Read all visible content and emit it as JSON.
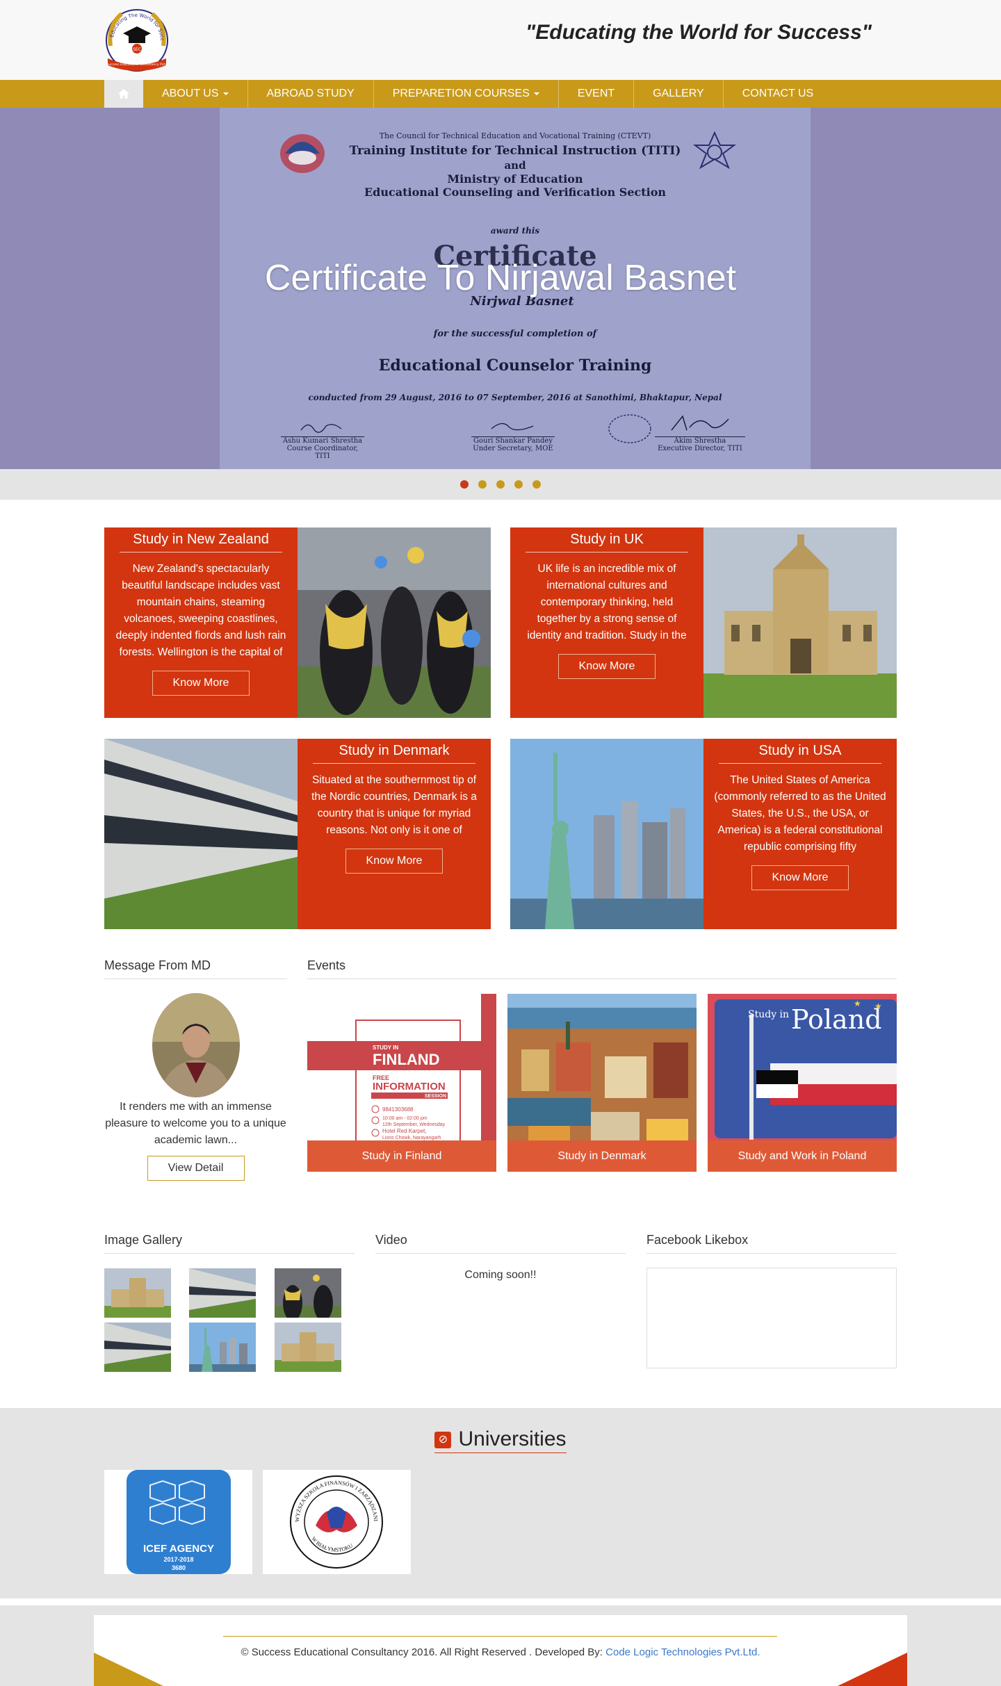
{
  "header": {
    "tagline": "\"Educating the World for Success\"",
    "logo": {
      "arc_text": "Educating The World for Success",
      "center_text": "SEC",
      "ribbon_text": "Success Educational Consultancy P.Ltd"
    }
  },
  "nav": {
    "home_icon": "home-icon",
    "items": [
      {
        "label": "ABOUT US",
        "dropdown": true
      },
      {
        "label": "ABROAD STUDY",
        "dropdown": false
      },
      {
        "label": "PREPARETION COURSES",
        "dropdown": true
      },
      {
        "label": "EVENT",
        "dropdown": false
      },
      {
        "label": "GALLERY",
        "dropdown": false
      },
      {
        "label": "CONTACT US",
        "dropdown": false
      }
    ]
  },
  "slider": {
    "caption": "Certificate To Nirjawal Basnet",
    "active_dot": 1,
    "dot_count": 5,
    "certificate": {
      "line1": "The Council for Technical Education and Vocational Training (CTEVT)",
      "line2": "Training Institute for Technical Instruction (TITI)",
      "line3": "and",
      "line4": "Ministry of Education",
      "line5": "Educational Counseling and Verification Section",
      "award": "award this",
      "heading": "Certificate",
      "name": "Nirjwal Basnet",
      "for": "for the successful completion of",
      "course": "Educational Counselor Training",
      "conducted": "conducted from 29 August, 2016  to 07 September, 2016 at Sanothimi, Bhaktapur, Nepal",
      "sig1_name": "Ashu Kumari Shrestha",
      "sig1_role": "Course Coordinator, TITI",
      "sig2_name": "Gouri Shankar Pandey",
      "sig2_role": "Under Secretary, MOE",
      "sig3_name": "Akim Shrestha",
      "sig3_role": "Executive Director, TITI"
    }
  },
  "countries": [
    {
      "title": "Study in New Zealand",
      "desc": "New Zealand's spectacularly beautiful landscape includes vast mountain chains, steaming volcanoes, sweeping coastlines, deeply indented fiords and lush rain forests. Wellington is the capital of",
      "button": "Know More"
    },
    {
      "title": "Study in UK",
      "desc": "UK life is an incredible mix of international cultures and contemporary thinking, held together by a strong sense of identity and tradition. Study in the",
      "button": "Know More"
    },
    {
      "title": "Study in Denmark",
      "desc": "Situated at the southernmost tip of the Nordic countries, Denmark is a country that is unique for myriad reasons. Not only is it one of",
      "button": "Know More"
    },
    {
      "title": "Study in USA",
      "desc": "The United States of America (commonly referred to as the United States, the U.S., the USA, or America) is a federal constitutional republic comprising fifty",
      "button": "Know More"
    }
  ],
  "message": {
    "title": "Message From MD",
    "text": "It renders me with an immense pleasure to welcome you to a unique academic lawn...",
    "button": "View Detail"
  },
  "events": {
    "title": "Events",
    "items": [
      {
        "label": "Study in Finland",
        "poster": {
          "study_in": "STUDY IN",
          "country": "FINLAND",
          "free": "FREE",
          "info": "INFORMATION",
          "session": "SESSION",
          "phone": "9841303688",
          "time": "10:00 am - 02:00 pm",
          "date": "12th September, Wednesday",
          "venue1": "Hotel Red Karpet,",
          "venue2": "Lions Chowk, Narayangarh"
        }
      },
      {
        "label": "Study in Denmark"
      },
      {
        "label": "Study and Work in Poland",
        "poster": {
          "study_in": "Study in",
          "country": "Poland"
        }
      }
    ]
  },
  "gallery": {
    "title": "Image Gallery"
  },
  "video": {
    "title": "Video",
    "text": "Coming soon!!"
  },
  "facebook": {
    "title": "Facebook Likebox"
  },
  "universities": {
    "title": "Universities",
    "icon": "university-icon",
    "items": [
      {
        "name": "ICEF AGENCY",
        "years": "2017-2018",
        "id": "3680"
      },
      {
        "name": "WYŻSZA SZKOŁA FINANSÓW I ZARZĄDZANIA",
        "sub": "W BIAŁYMSTOKU"
      }
    ]
  },
  "footer": {
    "text": "© Success Educational Consultancy 2016. All Right Reserved . Developed By:",
    "link": "Code Logic Technologies Pvt.Ltd."
  },
  "colors": {
    "accent": "#c99a1a",
    "brand_red": "#d2350f",
    "event_label": "#de5a36",
    "link": "#3a78c9"
  }
}
